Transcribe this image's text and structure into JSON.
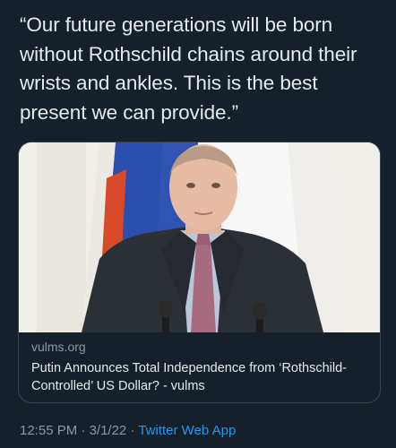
{
  "tweet": {
    "text": "“Our future generations will be born without Rothschild chains around their wrists and ankles. This is the best present we can provide.”"
  },
  "card": {
    "domain": "vulms.org",
    "title": "Putin Announces Total Independence from ‘Rothschild-Controlled’ US Dollar? - vulms"
  },
  "footer": {
    "time": "12:55 PM",
    "separator1": " · ",
    "date": "3/1/22",
    "separator2": " · ",
    "source": "Twitter Web App"
  },
  "colors": {
    "background": "#15202b",
    "text": "#e7e9ea",
    "secondary": "#8b98a5",
    "link": "#1d9bf0",
    "border": "#38444d"
  }
}
